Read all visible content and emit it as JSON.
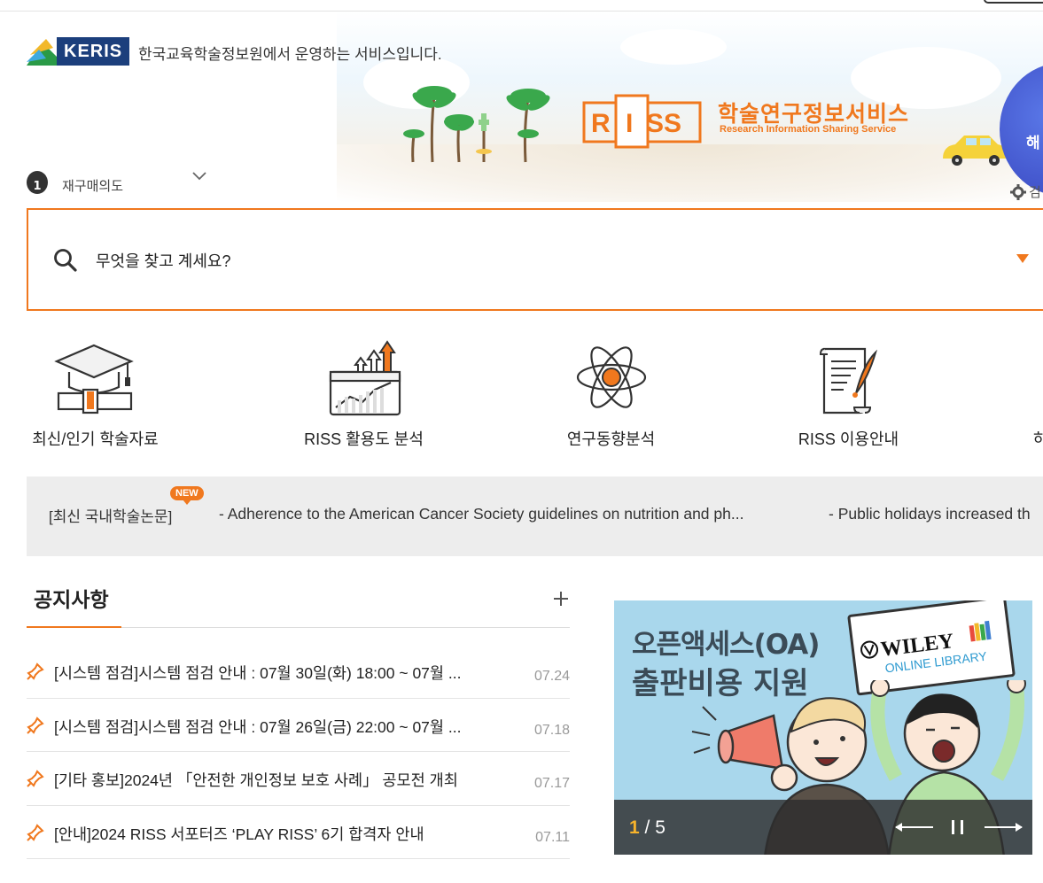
{
  "header": {
    "org_name": "KERIS",
    "org_desc": "한국교육학술정보원에서 운영하는 서비스입니다.",
    "logo_text": "RISS",
    "service_kor": "학술연구정보서비스",
    "service_eng": "Research Information Sharing Service",
    "bubble_text": "해",
    "settings_label": "검",
    "rank_number": "1",
    "rank_keyword": "재구매의도"
  },
  "search": {
    "placeholder": "무엇을 찾고 계세요?"
  },
  "quick_menu": [
    {
      "label": "최신/인기 학술자료",
      "icon": "graduation-cap-icon"
    },
    {
      "label": "RISS 활용도 분석",
      "icon": "chart-up-icon"
    },
    {
      "label": "연구동향분석",
      "icon": "atom-icon"
    },
    {
      "label": "RISS 이용안내",
      "icon": "document-quill-icon"
    },
    {
      "label": "하",
      "icon": ""
    }
  ],
  "latest": {
    "label": "[최신 국내학술논문]",
    "badge": "NEW",
    "items": [
      "- Adherence to the American Cancer Society guidelines on nutrition and ph...",
      "- Public holidays increased th"
    ]
  },
  "notices": {
    "title": "공지사항",
    "items": [
      {
        "text": "[시스템 점검]시스템 점검 안내 : 07월 30일(화) 18:00 ~ 07월 ...",
        "date": "07.24"
      },
      {
        "text": "[시스템 점검]시스템 점검 안내 : 07월 26일(금) 22:00 ~ 07월 ...",
        "date": "07.18"
      },
      {
        "text": "[기타 홍보]2024년 「안전한 개인정보 보호 사례」 공모전 개최",
        "date": "07.17"
      },
      {
        "text": "[안내]2024 RISS 서포터즈 ‘PLAY RISS’ 6기 합격자 안내",
        "date": "07.11"
      }
    ]
  },
  "banner": {
    "line1": "오픈액세스(OA)",
    "line2": "출판비용 지원",
    "sign_brand": "WILEY",
    "sign_sub": "ONLINE LIBRARY",
    "page_current": "1",
    "page_total": " / 5"
  },
  "colors": {
    "accent": "#f0781e",
    "keris_blue": "#1c3f7c"
  }
}
